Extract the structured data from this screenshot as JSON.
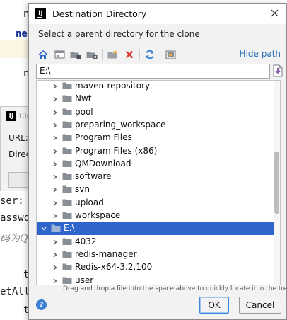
{
  "background": {
    "code_lines": [
      "n",
      "ne",
      "n",
      "ser:",
      "asswo",
      "码为Q",
      "t",
      "etAll",
      "t"
    ],
    "clone_dialog": {
      "title": "Clo",
      "url_label": "URL:",
      "directory_label": "Direc"
    }
  },
  "dialog": {
    "title": "Destination Directory",
    "subtitle": "Select a parent directory for the clone",
    "hide_path_label": "Hide path",
    "path_value": "E:\\",
    "drop_hint": "Drag and drop a file into the space above to quickly locate it in the tree",
    "ok_label": "OK",
    "cancel_label": "Cancel",
    "help_label": "?"
  },
  "toolbar": {
    "buttons": [
      "home-icon",
      "desktop-icon",
      "project-folder-icon",
      "module-folder-icon",
      "new-folder-icon",
      "delete-icon",
      "refresh-icon",
      "show-hidden-icon"
    ]
  },
  "tree": {
    "items": [
      {
        "label": "maven-repository",
        "level": 1
      },
      {
        "label": "Nwt",
        "level": 1
      },
      {
        "label": "pool",
        "level": 1
      },
      {
        "label": "preparing_workspace",
        "level": 1
      },
      {
        "label": "Program Files",
        "level": 1
      },
      {
        "label": "Program Files (x86)",
        "level": 1
      },
      {
        "label": "QMDownload",
        "level": 1
      },
      {
        "label": "software",
        "level": 1
      },
      {
        "label": "svn",
        "level": 1
      },
      {
        "label": "upload",
        "level": 1
      },
      {
        "label": "workspace",
        "level": 1
      },
      {
        "label": "E:\\",
        "level": 0,
        "selected": true,
        "expanded": true
      },
      {
        "label": "4032",
        "level": 1
      },
      {
        "label": "redis-manager",
        "level": 1
      },
      {
        "label": "Redis-x64-3.2.100",
        "level": 1
      },
      {
        "label": "user",
        "level": 1
      }
    ]
  },
  "colors": {
    "selection": "#2f65ca",
    "link": "#2470b3",
    "folder": "#8a8f96",
    "delete": "#d9342b",
    "refresh": "#2e7bd6"
  }
}
